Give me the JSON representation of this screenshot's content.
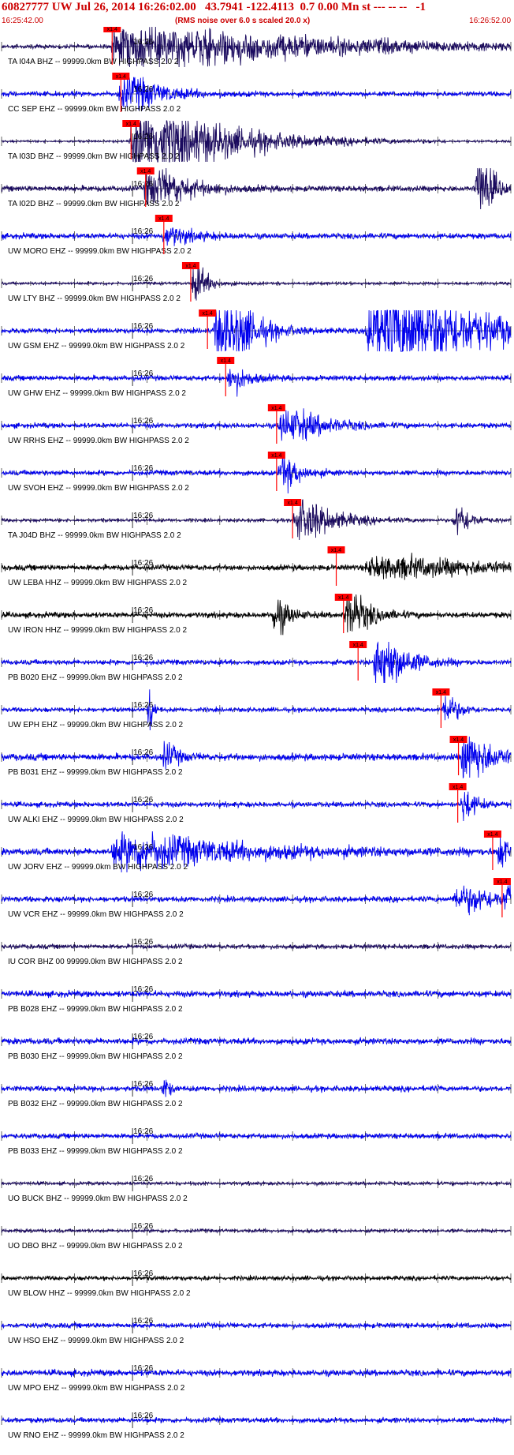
{
  "header": {
    "title": "60827777 UW Jul 26, 2014 16:26:02.00   43.7941 -122.4113  0.7 0.00 Mn st --- -- --   -1",
    "start_time": "16:25:42.00",
    "end_time": "16:26:52.00",
    "note": "(RMS noise over 6.0 s scaled 20.0 x)"
  },
  "chart_data": {
    "type": "line",
    "title": "60827777 UW Jul 26, 2014 16:26:02.00   43.7941 -122.4113  0.7 0.00 Mn st --- -- --   -1",
    "x_unit": "seconds from 16:25:42.00",
    "xlim": [
      0,
      70
    ],
    "minute_label": "16:26",
    "minute_label_time_s": 18,
    "pick_label": "x1.4",
    "colors": {
      "navy": "#1a0a5e",
      "blue": "#0000ee",
      "black": "#000000",
      "pick": "#ff0000",
      "axis": "#000000",
      "header": "#cc0000"
    },
    "traces": [
      {
        "label": "TA I04A BHZ -- 99999.0km BW  HIGHPASS  2.0  2",
        "color": "navy",
        "pick_s": 15.2,
        "amp": 0.35,
        "bursts": [
          [
            15,
            30,
            3.2,
            22
          ]
        ]
      },
      {
        "label": "CC SEP EHZ -- 99999.0km BW  HIGHPASS  2.0  2",
        "color": "blue",
        "pick_s": 16.4,
        "amp": 0.45,
        "bursts": [
          [
            16,
            8,
            2.5,
            4
          ]
        ]
      },
      {
        "label": "TA I03D BHZ -- 99999.0km BW  HIGHPASS  2.0  2",
        "color": "navy",
        "pick_s": 17.8,
        "amp": 0.2,
        "bursts": [
          [
            17.5,
            14,
            6,
            10
          ]
        ]
      },
      {
        "label": "TA I02D BHZ -- 99999.0km BW  HIGHPASS  2.0  2",
        "color": "navy",
        "pick_s": 19.8,
        "amp": 0.5,
        "bursts": [
          [
            19.5,
            8,
            3,
            4
          ],
          [
            65,
            3,
            6,
            1.5
          ]
        ]
      },
      {
        "label": "UW MORO EHZ -- 99999.0km BW  HIGHPASS  2.0  2",
        "color": "blue",
        "pick_s": 22.3,
        "amp": 0.5,
        "bursts": [
          [
            22,
            4,
            1.5,
            3
          ]
        ]
      },
      {
        "label": "UW LTY BHZ -- 99999.0km BW  HIGHPASS  2.0  2",
        "color": "navy",
        "pick_s": 26.0,
        "amp": 0.25,
        "bursts": [
          [
            26,
            3,
            3,
            1.5
          ]
        ]
      },
      {
        "label": "UW GSM EHZ -- 99999.0km BW  HIGHPASS  2.0  2",
        "color": "blue",
        "pick_s": 28.3,
        "amp": 0.45,
        "bursts": [
          [
            29,
            10,
            5,
            3
          ],
          [
            50,
            20,
            7,
            10
          ]
        ]
      },
      {
        "label": "UW GHW EHZ -- 99999.0km BW  HIGHPASS  2.0  2",
        "color": "blue",
        "pick_s": 30.8,
        "amp": 0.45,
        "bursts": [
          [
            31,
            3,
            2.2,
            2
          ]
        ]
      },
      {
        "label": "UW RRHS EHZ -- 99999.0km BW  HIGHPASS  2.0  2",
        "color": "blue",
        "pick_s": 37.8,
        "amp": 0.45,
        "bursts": [
          [
            38,
            8,
            2.5,
            4
          ]
        ]
      },
      {
        "label": "UW SVOH EHZ -- 99999.0km BW  HIGHPASS  2.0  2",
        "color": "blue",
        "pick_s": 37.8,
        "amp": 0.45,
        "bursts": [
          [
            38,
            3,
            3,
            2
          ]
        ]
      },
      {
        "label": "TA J04D BHZ -- 99999.0km BW  HIGHPASS  2.0  2",
        "color": "navy",
        "pick_s": 40.0,
        "amp": 0.3,
        "bursts": [
          [
            40,
            6,
            3.5,
            4
          ],
          [
            62,
            3,
            2.8,
            1.5
          ]
        ]
      },
      {
        "label": "UW LEBA HHZ -- 99999.0km BW  HIGHPASS  2.0  2",
        "color": "black",
        "pick_s": 46.0,
        "amp": 0.5,
        "bursts": [
          [
            50,
            15,
            1.6,
            15
          ]
        ]
      },
      {
        "label": "UW IRON HHZ -- 99999.0km BW  HIGHPASS  2.0  2",
        "color": "black",
        "pick_s": 47.0,
        "amp": 0.5,
        "bursts": [
          [
            37,
            3,
            3,
            1.5
          ],
          [
            47,
            4,
            3.5,
            2.5
          ]
        ]
      },
      {
        "label": "PB B020 EHZ -- 99999.0km BW  HIGHPASS  2.0  2",
        "color": "blue",
        "pick_s": 49.0,
        "amp": 0.45,
        "bursts": [
          [
            51,
            5,
            5,
            3
          ]
        ]
      },
      {
        "label": "UW EPH EHZ -- 99999.0km BW  HIGHPASS  2.0  2",
        "color": "blue",
        "pick_s": 60.4,
        "amp": 0.4,
        "bursts": [
          [
            20,
            1,
            5,
            0.4
          ],
          [
            60.5,
            2,
            3,
            1.5
          ]
        ]
      },
      {
        "label": "PB B031 EHZ -- 99999.0km BW  HIGHPASS  2.0  2",
        "color": "blue",
        "pick_s": 62.8,
        "amp": 0.6,
        "bursts": [
          [
            22,
            2,
            2.2,
            1.5
          ],
          [
            63,
            5,
            4,
            3
          ]
        ]
      },
      {
        "label": "UW ALKI EHZ -- 99999.0km BW  HIGHPASS  2.0  2",
        "color": "blue",
        "pick_s": 62.7,
        "amp": 0.45,
        "bursts": [
          [
            63,
            2,
            2.8,
            1.5
          ]
        ]
      },
      {
        "label": "UW JORV EHZ -- 99999.0km BW  HIGHPASS  2.0  2",
        "color": "blue",
        "pick_s": 67.5,
        "amp": 0.6,
        "bursts": [
          [
            15,
            15,
            2.8,
            14
          ],
          [
            68,
            2,
            3,
            1.5
          ]
        ]
      },
      {
        "label": "UW VCR EHZ -- 99999.0km BW  HIGHPASS  2.0  2",
        "color": "blue",
        "pick_s": 68.8,
        "amp": 0.5,
        "bursts": [
          [
            62,
            8,
            2,
            4
          ],
          [
            69,
            1.5,
            4,
            1
          ]
        ]
      },
      {
        "label": "IU COR BHZ 00 99999.0km BW  HIGHPASS  2.0  2",
        "color": "navy",
        "amp": 0.4,
        "bursts": []
      },
      {
        "label": "PB B028 EHZ -- 99999.0km BW  HIGHPASS  2.0  2",
        "color": "blue",
        "amp": 0.55,
        "bursts": []
      },
      {
        "label": "PB B030 EHZ -- 99999.0km BW  HIGHPASS  2.0  2",
        "color": "blue",
        "amp": 0.55,
        "bursts": []
      },
      {
        "label": "PB B032 EHZ -- 99999.0km BW  HIGHPASS  2.0  2",
        "color": "blue",
        "amp": 0.5,
        "bursts": [
          [
            22,
            1,
            2.5,
            0.6
          ]
        ]
      },
      {
        "label": "PB B033 EHZ -- 99999.0km BW  HIGHPASS  2.0  2",
        "color": "blue",
        "amp": 0.45,
        "bursts": []
      },
      {
        "label": "UO BUCK BHZ -- 99999.0km BW  HIGHPASS  2.0  2",
        "color": "navy",
        "amp": 0.3,
        "bursts": []
      },
      {
        "label": "UO DBO BHZ -- 99999.0km BW  HIGHPASS  2.0  2",
        "color": "navy",
        "amp": 0.3,
        "bursts": []
      },
      {
        "label": "UW BLOW HHZ -- 99999.0km BW  HIGHPASS  2.0  2",
        "color": "black",
        "amp": 0.4,
        "bursts": []
      },
      {
        "label": "UW HSO EHZ -- 99999.0km BW  HIGHPASS  2.0  2",
        "color": "blue",
        "amp": 0.45,
        "bursts": []
      },
      {
        "label": "UW MPO EHZ -- 99999.0km BW  HIGHPASS  2.0  2",
        "color": "blue",
        "amp": 0.55,
        "bursts": []
      },
      {
        "label": "UW RNO EHZ -- 99999.0km BW  HIGHPASS  2.0  2",
        "color": "blue",
        "amp": 0.45,
        "bursts": []
      }
    ]
  }
}
